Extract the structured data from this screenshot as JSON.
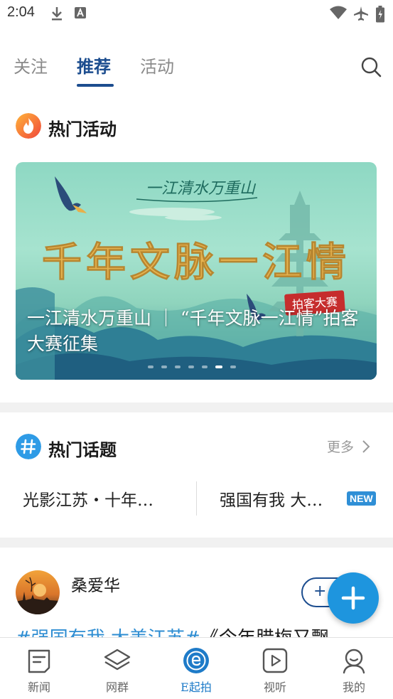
{
  "status_bar": {
    "time": "2:04",
    "icons": [
      "download-icon",
      "font-icon",
      "wifi-icon",
      "airplane-icon",
      "battery-icon"
    ]
  },
  "top_tabs": {
    "items": [
      {
        "label": "关注",
        "active": false
      },
      {
        "label": "推荐",
        "active": true
      },
      {
        "label": "活动",
        "active": false
      }
    ],
    "search_icon": "search-icon",
    "accent": "#1c4d8f"
  },
  "hot_activities": {
    "title": "热门活动",
    "icon": "fire-icon",
    "banner": {
      "caption": "一江清水万重山 ｜ “千年文脉一江情”拍客大赛征集",
      "art_title": "一江清水万重山",
      "art_headline": "千年文脉一江情",
      "art_stamp": "拍客大赛",
      "slide_count": 6,
      "active_slide": 5
    }
  },
  "hot_topics": {
    "title": "热门话题",
    "icon": "hashtag-icon",
    "more_label": "更多",
    "items": [
      {
        "label": "光影江苏・十年…",
        "badge": ""
      },
      {
        "label": "强国有我  大…",
        "badge": "NEW"
      }
    ]
  },
  "post": {
    "username": "桑爱华",
    "follow_label": "+",
    "text_hashtag": "#强国有我 大美江苏#",
    "text_plain": "《今年腊梅又飘"
  },
  "fab": {
    "icon": "plus-icon",
    "color": "#1e95de"
  },
  "bottom_nav": {
    "items": [
      {
        "label": "新闻",
        "icon": "news-icon",
        "active": false
      },
      {
        "label": "网群",
        "icon": "layers-icon",
        "active": false
      },
      {
        "label": "E起拍",
        "icon": "e-camera-icon",
        "active": true
      },
      {
        "label": "视听",
        "icon": "video-play-icon",
        "active": false
      },
      {
        "label": "我的",
        "icon": "profile-icon",
        "active": false
      }
    ]
  }
}
